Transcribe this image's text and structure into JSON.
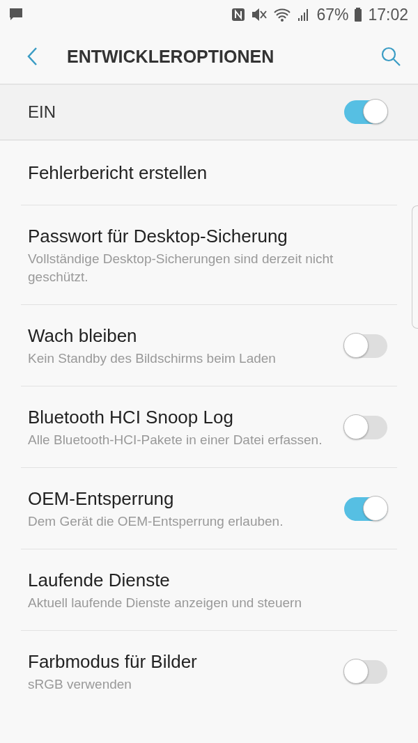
{
  "status_bar": {
    "battery": "67%",
    "time": "17:02"
  },
  "header": {
    "title": "ENTWICKLEROPTIONEN"
  },
  "master_switch": {
    "label": "EIN",
    "on": true
  },
  "settings": [
    {
      "kind": "plain",
      "title": "Fehlerbericht erstellen"
    },
    {
      "kind": "plain",
      "title": "Passwort für Desktop-Sicherung",
      "subtitle": "Vollständige Desktop-Sicherungen sind derzeit nicht geschützt."
    },
    {
      "kind": "toggle",
      "title": "Wach bleiben",
      "subtitle": "Kein Standby des Bildschirms beim Laden",
      "on": false
    },
    {
      "kind": "toggle",
      "title": "Bluetooth HCI Snoop Log",
      "subtitle": "Alle Bluetooth-HCI-Pakete in einer Datei erfassen.",
      "on": false
    },
    {
      "kind": "toggle",
      "title": "OEM-Entsperrung",
      "subtitle": "Dem Gerät die OEM-Entsperrung erlauben.",
      "on": true
    },
    {
      "kind": "plain",
      "title": "Laufende Dienste",
      "subtitle": "Aktuell laufende Dienste anzeigen und steuern"
    },
    {
      "kind": "toggle",
      "title": "Farbmodus für Bilder",
      "subtitle": "sRGB verwenden",
      "on": false
    }
  ]
}
